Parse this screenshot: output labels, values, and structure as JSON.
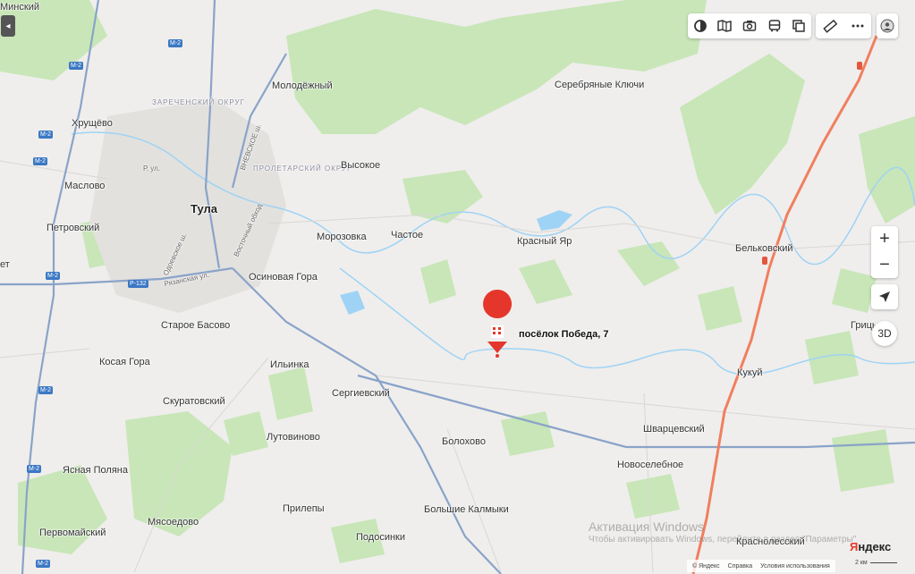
{
  "map": {
    "cities": [
      "Тула"
    ],
    "districts": [
      "ЗАРЕЧЕНСКИЙ ОКРУГ",
      "ПРОЛЕТАРСКИЙ ОКРУГ"
    ],
    "roads": [
      "ВНЕВСКОЕ ш.",
      "Рязанская ул.",
      "Восточный обход",
      "Одоевское ш.",
      "Р. ул."
    ],
    "places": {
      "molodezhny": "Молодёжный",
      "serebryanye_klyuchi": "Серебряные Ключи",
      "khrushchevo": "Хрущёво",
      "vysokoe": "Высокое",
      "maslovo": "Маслово",
      "petrovsky": "Петровский",
      "morozovka": "Морозовка",
      "chastoe": "Частое",
      "krasny_yar": "Красный Яр",
      "belkovsky": "Бельковский",
      "osinovaya_gora": "Осиновая Гора",
      "staroe_basovo": "Старое Басово",
      "kosaya_gora": "Косая Гора",
      "ilyinka": "Ильинка",
      "kukuy": "Кукуй",
      "sergievsky": "Сергиевский",
      "skuratovsky": "Скуратовский",
      "shvartsevsky": "Шварцевский",
      "lutovinovo": "Лутовиново",
      "bolokhovo": "Болохово",
      "novoselebnoe": "Новоселебное",
      "yasnaya_polyana": "Ясная Поляна",
      "prilepy": "Прилепы",
      "bolshie_kalmyki": "Большие Калмыки",
      "myasoedovo": "Мясоедово",
      "pervomaysky": "Первомайский",
      "podosinki": "Подосинки",
      "krasnolessky": "Краснолесский",
      "gritsy": "Грицы",
      "minsky": "Минский",
      "et": "ет"
    },
    "shields": [
      "М-2",
      "Р-132"
    ],
    "pin": {
      "label": "посёлок Победа, 7",
      "icon": "building-icon"
    },
    "colors": {
      "forest": "#c8e6b8",
      "water": "#9fd3f5",
      "highway": "#f07f5f",
      "major_road": "#8aa3c9",
      "pin": "#e5362c"
    }
  },
  "controls": {
    "back_icon": "◂",
    "top_toolbar": [
      "layers-icon",
      "panorama-icon",
      "camera-icon",
      "transport-icon",
      "traffic-icon"
    ],
    "top_toolbar2": [
      "ruler-icon",
      "more-icon"
    ],
    "zoom_in": "+",
    "zoom_out": "−",
    "view_3d": "3D",
    "geolocation_icon": "navigation-arrow-icon"
  },
  "watermark": {
    "line1": "Активация Windows",
    "line2": "Чтобы активировать Windows, перейдите в раздел \"Параметры\""
  },
  "brand": {
    "first": "Я",
    "rest": "ндекс"
  },
  "footer": {
    "copyright": "© Яндекс",
    "help": "Справка",
    "terms": "Условия использования",
    "scale": "2 км"
  }
}
